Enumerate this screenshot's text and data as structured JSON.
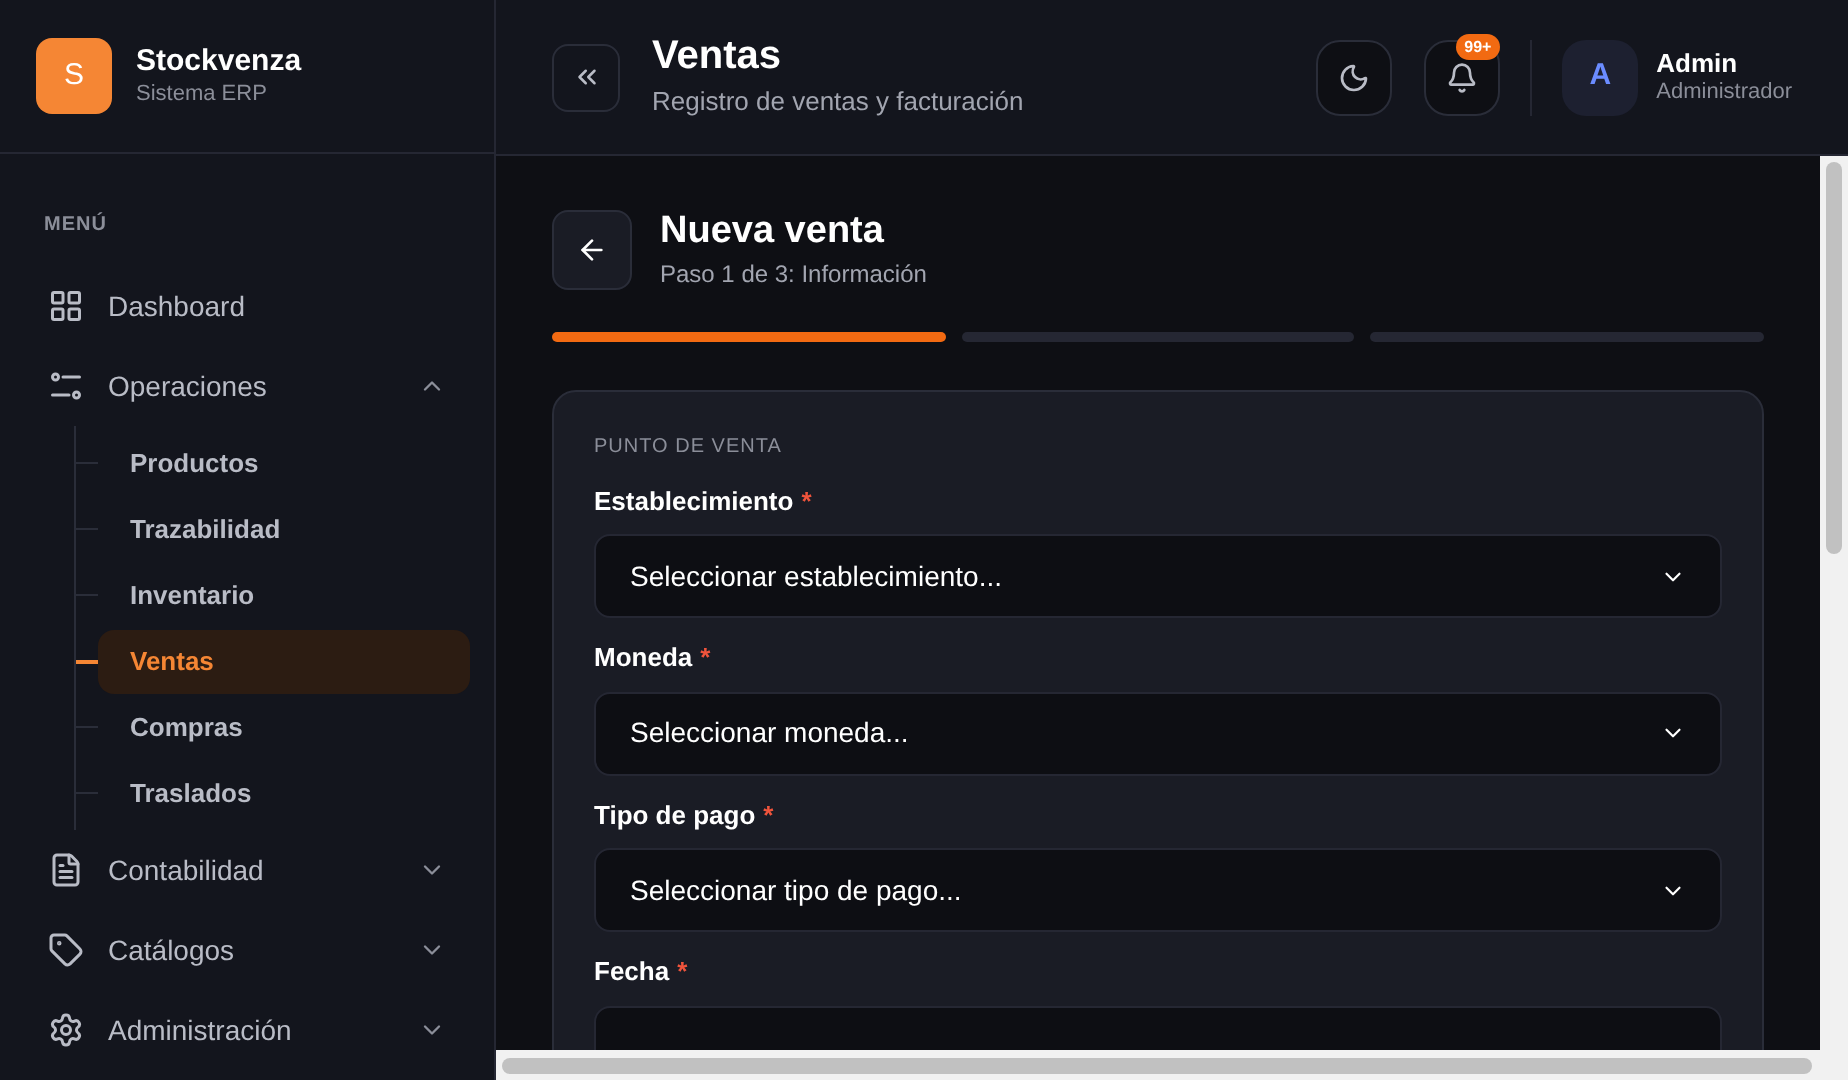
{
  "brand": {
    "initial": "S",
    "name": "Stockvenza",
    "subtitle": "Sistema ERP"
  },
  "sidebar": {
    "section_label": "MENÚ",
    "items": [
      {
        "kind": "link",
        "label": "Dashboard"
      },
      {
        "kind": "group",
        "label": "Operaciones",
        "expanded": true,
        "children": [
          {
            "label": "Productos",
            "selected": false
          },
          {
            "label": "Trazabilidad",
            "selected": false
          },
          {
            "label": "Inventario",
            "selected": false
          },
          {
            "label": "Ventas",
            "selected": true
          },
          {
            "label": "Compras",
            "selected": false
          },
          {
            "label": "Traslados",
            "selected": false
          }
        ]
      },
      {
        "kind": "group",
        "label": "Contabilidad",
        "expanded": false
      },
      {
        "kind": "group",
        "label": "Catálogos",
        "expanded": false
      },
      {
        "kind": "group",
        "label": "Administración",
        "expanded": false
      }
    ]
  },
  "header": {
    "title": "Ventas",
    "subtitle": "Registro de ventas y facturación",
    "notification_badge": "99+",
    "user": {
      "initial": "A",
      "name": "Admin",
      "role": "Administrador"
    }
  },
  "page": {
    "title": "Nueva venta",
    "subtitle": "Paso 1 de 3: Información",
    "steps": [
      {
        "active": true
      },
      {
        "active": false
      },
      {
        "active": false
      }
    ],
    "card": {
      "section_label": "PUNTO DE VENTA",
      "fields": [
        {
          "label": "Establecimiento",
          "required_mark": "*",
          "value": "Seleccionar establecimiento..."
        },
        {
          "label": "Moneda",
          "required_mark": "*",
          "value": "Seleccionar moneda..."
        },
        {
          "label": "Tipo de pago",
          "required_mark": "*",
          "value": "Seleccionar tipo de pago..."
        },
        {
          "label": "Fecha",
          "required_mark": "*"
        }
      ]
    }
  }
}
